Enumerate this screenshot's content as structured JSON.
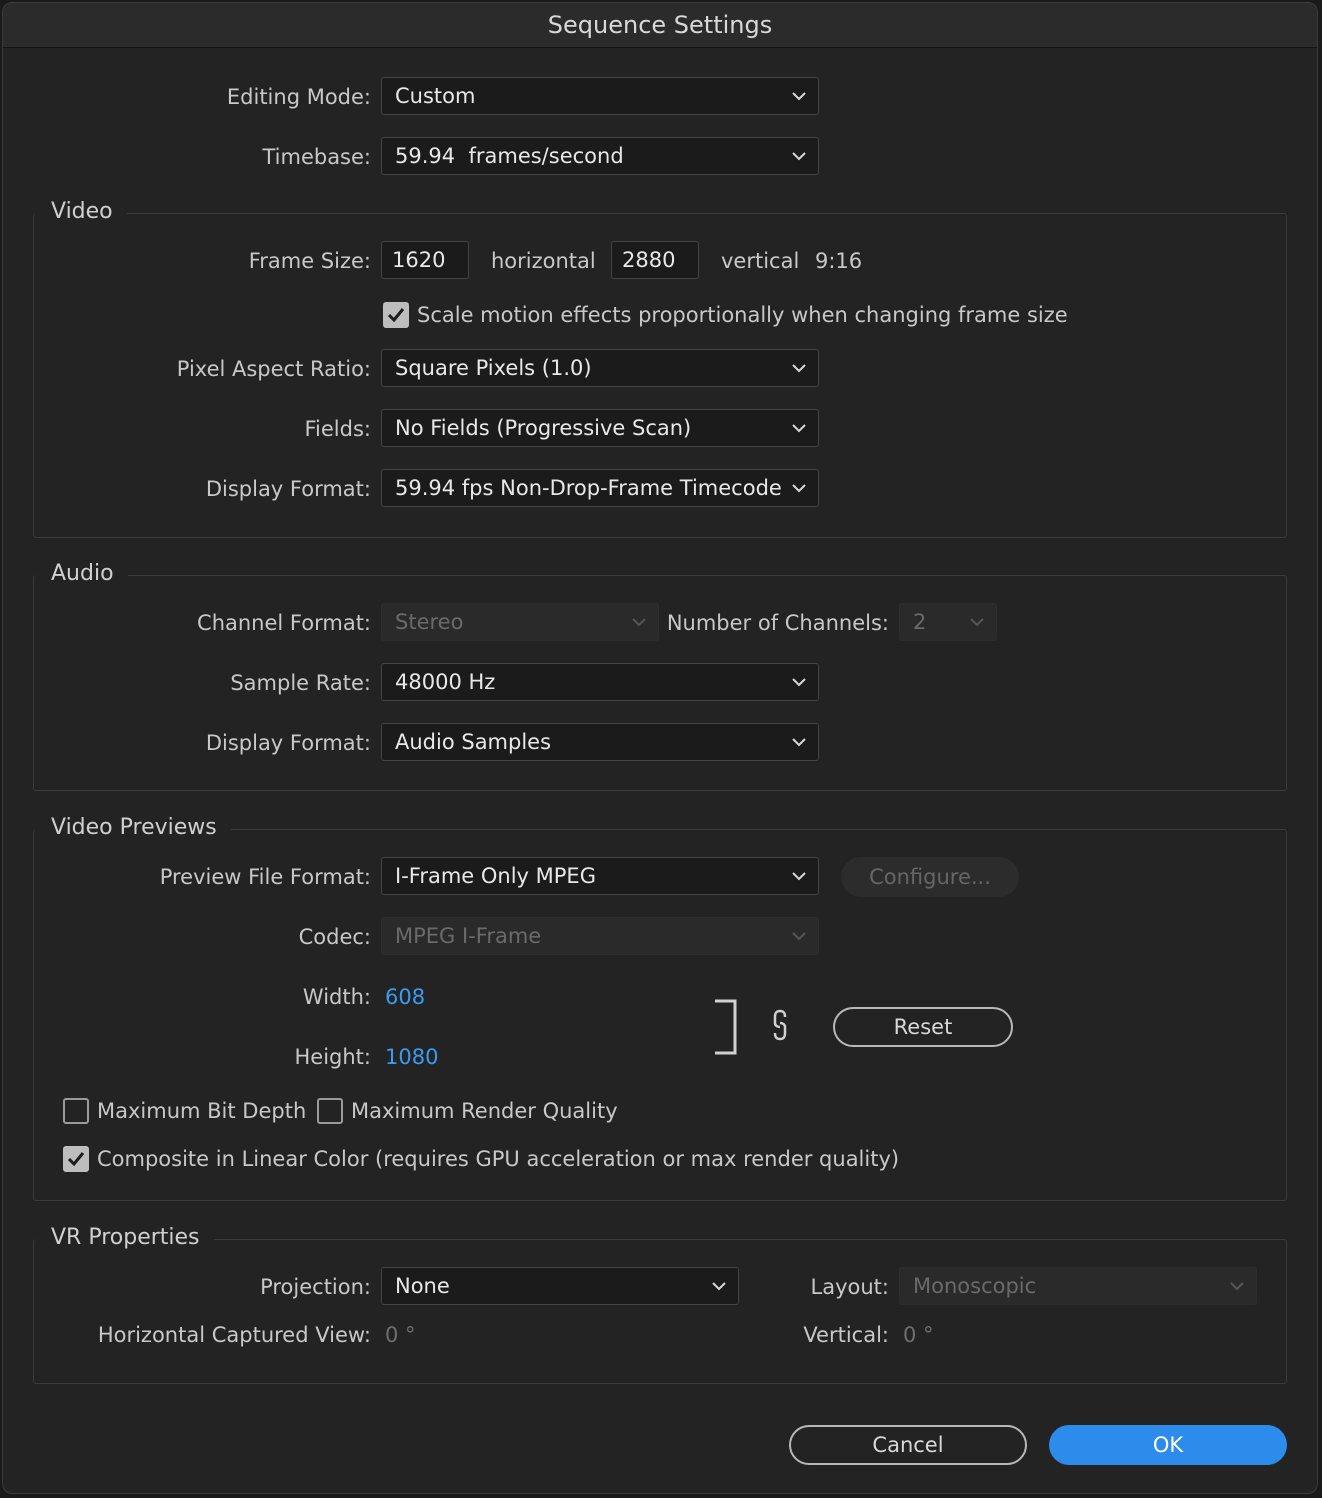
{
  "window": {
    "title": "Sequence Settings"
  },
  "top": {
    "editing_mode_label": "Editing Mode:",
    "editing_mode_value": "Custom",
    "timebase_label": "Timebase:",
    "timebase_value": "59.94  frames/second"
  },
  "video": {
    "title": "Video",
    "frame_size_label": "Frame Size:",
    "frame_width": "1620",
    "horizontal_label": "horizontal",
    "frame_height": "2880",
    "vertical_label": "vertical",
    "aspect": "9:16",
    "scale_motion_label": "Scale motion effects proportionally when changing frame size",
    "scale_motion_checked": true,
    "pixel_aspect_label": "Pixel Aspect Ratio:",
    "pixel_aspect_value": "Square Pixels (1.0)",
    "fields_label": "Fields:",
    "fields_value": "No Fields (Progressive Scan)",
    "display_format_label": "Display Format:",
    "display_format_value": "59.94 fps Non-Drop-Frame Timecode"
  },
  "audio": {
    "title": "Audio",
    "channel_format_label": "Channel Format:",
    "channel_format_value": "Stereo",
    "num_channels_label": "Number of Channels:",
    "num_channels_value": "2",
    "sample_rate_label": "Sample Rate:",
    "sample_rate_value": "48000 Hz",
    "display_format_label": "Display Format:",
    "display_format_value": "Audio Samples"
  },
  "previews": {
    "title": "Video Previews",
    "file_format_label": "Preview File Format:",
    "file_format_value": "I-Frame Only MPEG",
    "configure_label": "Configure...",
    "codec_label": "Codec:",
    "codec_value": "MPEG I-Frame",
    "width_label": "Width:",
    "width_value": "608",
    "height_label": "Height:",
    "height_value": "1080",
    "reset_label": "Reset",
    "max_bit_depth_label": "Maximum Bit Depth",
    "max_bit_depth_checked": false,
    "max_render_label": "Maximum Render Quality",
    "max_render_checked": false,
    "linear_color_label": "Composite in Linear Color (requires GPU acceleration or max render quality)",
    "linear_color_checked": true
  },
  "vr": {
    "title": "VR Properties",
    "projection_label": "Projection:",
    "projection_value": "None",
    "layout_label": "Layout:",
    "layout_value": "Monoscopic",
    "h_view_label": "Horizontal Captured View:",
    "h_view_value": "0 °",
    "vertical_label": "Vertical:",
    "vertical_value": "0 °"
  },
  "footer": {
    "cancel_label": "Cancel",
    "ok_label": "OK"
  },
  "colors": {
    "accent": "#2d8ceb",
    "link_value": "#3b9bf0",
    "background": "#232323"
  }
}
